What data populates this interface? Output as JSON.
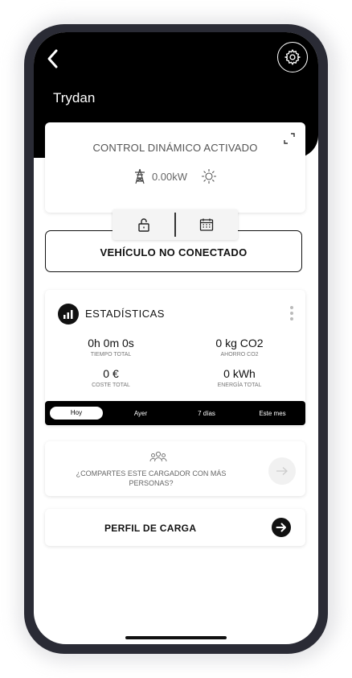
{
  "header": {
    "title": "Trydan",
    "back_icon": "chevron-left-icon",
    "settings_icon": "gear-icon"
  },
  "dynamic_control": {
    "title": "CONTROL DINÁMICO ACTIVADO",
    "power_value": "0.00kW",
    "grid_icon": "power-tower-icon",
    "solar_icon": "sun-icon",
    "expand_icon": "expand-icon"
  },
  "action_tabs": [
    {
      "icon": "unlock-icon"
    },
    {
      "icon": "calendar-icon"
    }
  ],
  "vehicle_status": "VEHÍCULO NO CONECTADO",
  "statistics": {
    "title": "ESTADÍSTICAS",
    "items": [
      {
        "value": "0h 0m 0s",
        "label": "TIEMPO TOTAL"
      },
      {
        "value": "0 kg CO2",
        "label": "AHORRO CO2"
      },
      {
        "value": "0 €",
        "label": "COSTE TOTAL"
      },
      {
        "value": "0 kWh",
        "label": "ENERGÍA TOTAL"
      }
    ],
    "periods": [
      "Hoy",
      "Ayer",
      "7 días",
      "Este mes"
    ],
    "active_period": "Hoy"
  },
  "share": {
    "text": "¿COMPARTES ESTE CARGADOR CON MÁS PERSONAS?",
    "icon": "group-icon"
  },
  "charge_profile": {
    "label": "PERFIL DE CARGA",
    "icon": "arrow-right-icon"
  },
  "colors": {
    "header_bg": "#000000",
    "phone_frame": "#2a2b35",
    "accent": "#111111"
  }
}
